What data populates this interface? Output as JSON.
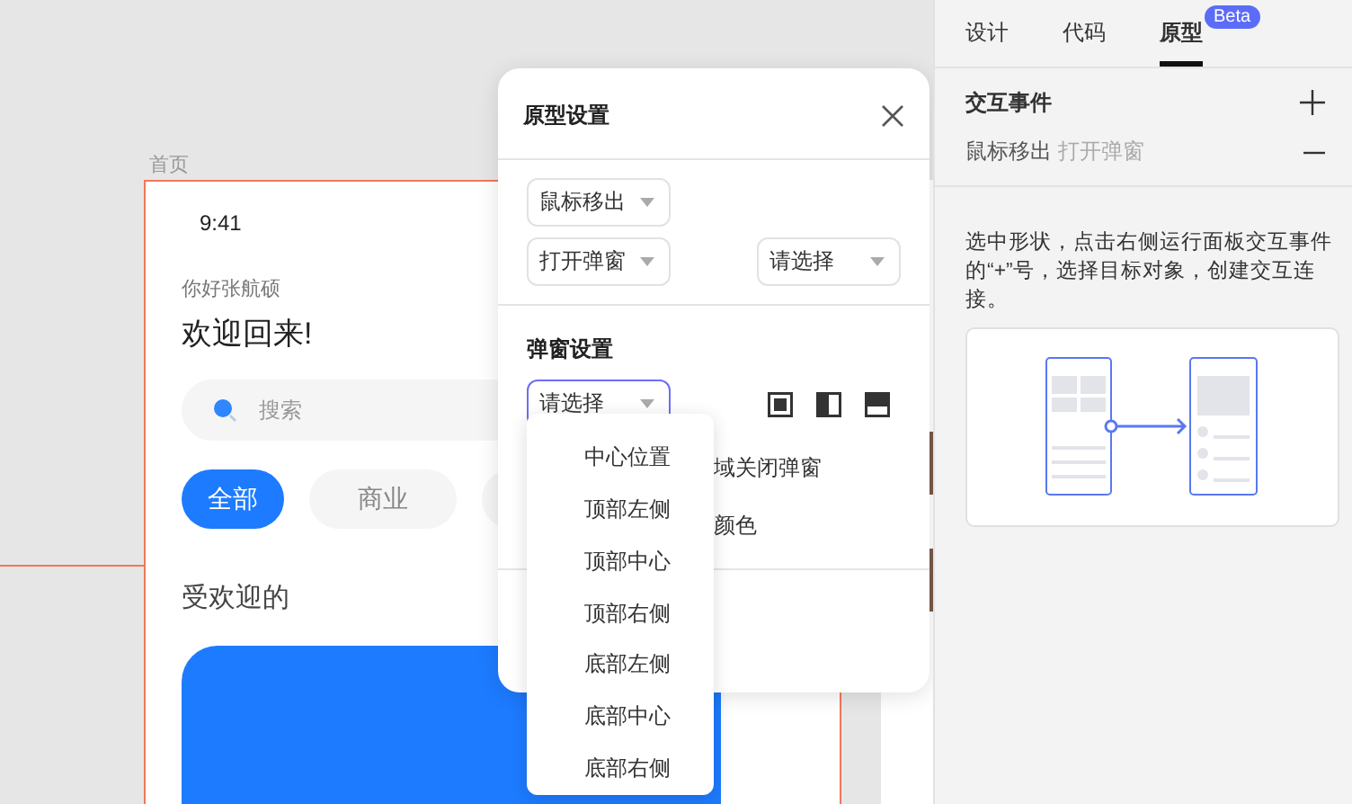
{
  "canvas": {
    "frame_label": "首页",
    "phone": {
      "time": "9:41",
      "greeting": "你好张航硕",
      "title": "欢迎回来!",
      "search": {
        "placeholder": "搜索"
      },
      "chips": [
        {
          "label": "全部",
          "selected": true
        },
        {
          "label": "商业",
          "selected": false
        }
      ],
      "section_title": "受欢迎的"
    }
  },
  "popup": {
    "title": "原型设置",
    "event_select": "鼠标移出",
    "action_select": "打开弹窗",
    "target_select": "请选择",
    "section_title": "弹窗设置",
    "position_select": {
      "value": "请选择",
      "focused": true
    },
    "partial_rows": [
      "域关闭弹窗",
      "颜色"
    ],
    "dropdown": [
      {
        "label": "中心位置",
        "selected": false
      },
      {
        "label": "顶部左侧",
        "selected": false
      },
      {
        "label": "顶部中心",
        "selected": false
      },
      {
        "label": "顶部右侧",
        "selected": false
      },
      {
        "label": "底部左侧",
        "selected": false
      },
      {
        "label": "底部中心",
        "selected": false
      },
      {
        "label": "底部右侧",
        "selected": false
      }
    ]
  },
  "panel": {
    "tabs": [
      {
        "label": "设计",
        "selected": false
      },
      {
        "label": "代码",
        "selected": false
      },
      {
        "label": "原型",
        "selected": true,
        "badge": "Beta"
      }
    ],
    "section_title": "交互事件",
    "events": [
      {
        "trigger": "鼠标移出",
        "action": "打开弹窗"
      }
    ],
    "help_text": "选中形状，点击右侧运行面板交互事件的“+”号，选择目标对象，创建交互连接。"
  }
}
